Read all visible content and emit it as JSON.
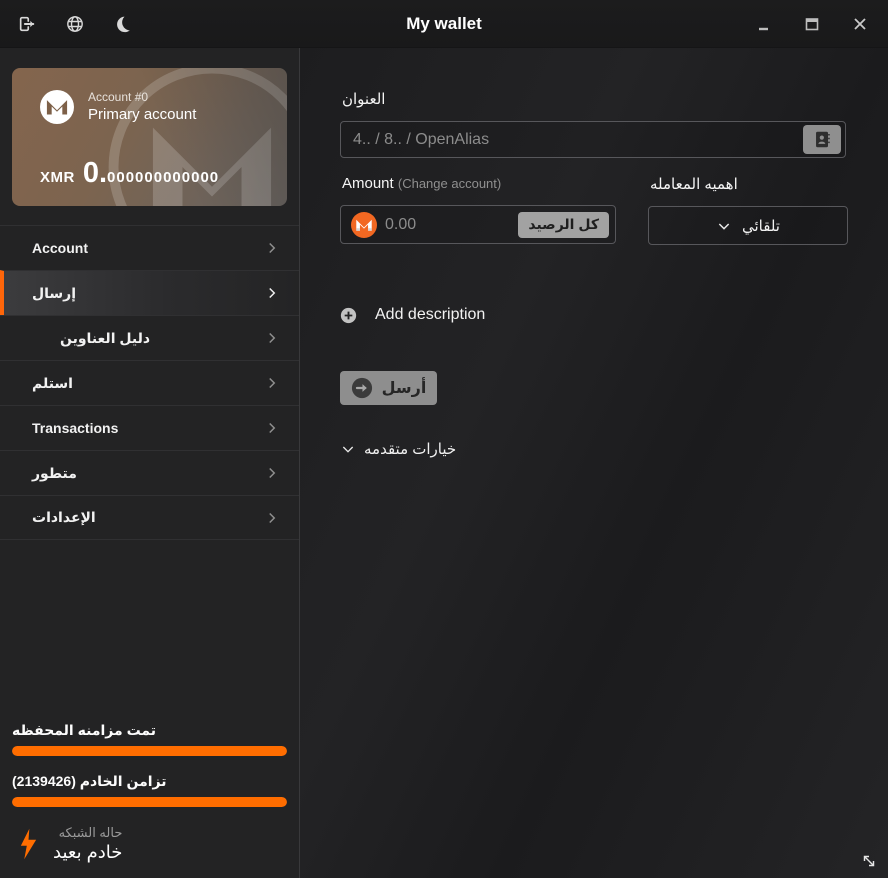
{
  "titlebar": {
    "title": "My wallet",
    "icons": [
      "logout-icon",
      "globe-icon",
      "moon-icon",
      "minimize-icon",
      "maximize-icon",
      "close-icon"
    ]
  },
  "account_card": {
    "account_number": "Account #0",
    "account_name": "Primary account",
    "currency": "XMR",
    "balance_whole": "0.",
    "balance_fraction": "000000000000"
  },
  "sidebar": {
    "items": [
      {
        "label": "Account"
      },
      {
        "label": "إرسال"
      },
      {
        "label": "دليل العناوين"
      },
      {
        "label": "استلم"
      },
      {
        "label": "Transactions"
      },
      {
        "label": "متطور"
      },
      {
        "label": "الإعدادات"
      }
    ],
    "active_item": "إرسال",
    "status": {
      "wallet_sync_label": "تمت مزامنه المحفظه",
      "wallet_sync_progress": 100,
      "daemon_sync_label": "تزامن الخادم (2139426)",
      "daemon_sync_progress": 100,
      "network_label": "حاله الشبكه",
      "network_value": "خادم بعيد"
    }
  },
  "send_form": {
    "address_label": "العنوان",
    "address_placeholder": "4.. / 8.. / OpenAlias",
    "amount_label": "Amount",
    "change_account_label": "(Change account)",
    "amount_placeholder": "0.00",
    "all_balance_button": "كل الرصيد",
    "priority_label": "اهميه المعامله",
    "priority_selected": "تلقائي",
    "add_description_label": "Add description",
    "send_button": "أرسل",
    "advanced_options_label": "خيارات متقدمه"
  },
  "colors": {
    "accent_orange": "#ff6d00",
    "monero_orange": "#f26822",
    "card_brown": "#7d6048",
    "sidebar_bg": "#232324",
    "main_bg": "#1e1e1f"
  }
}
